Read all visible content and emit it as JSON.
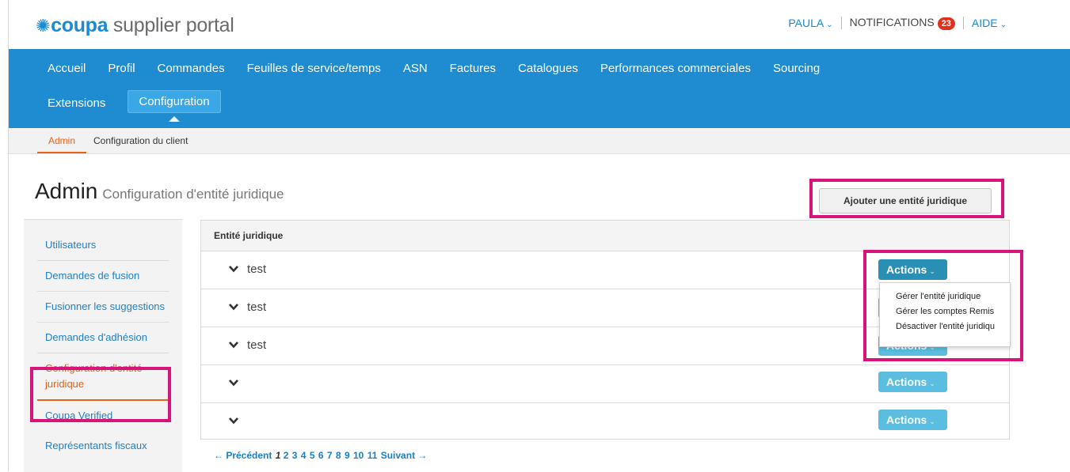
{
  "header": {
    "logo_brand": "coupa",
    "logo_rest": "supplier portal",
    "user": "PAULA",
    "notifications_label": "NOTIFICATIONS",
    "notifications_count": "23",
    "help": "AIDE"
  },
  "nav": {
    "row1": [
      "Accueil",
      "Profil",
      "Commandes",
      "Feuilles de service/temps",
      "ASN",
      "Factures",
      "Catalogues",
      "Performances commerciales",
      "Sourcing"
    ],
    "extensions": "Extensions",
    "configuration": "Configuration"
  },
  "subnav": {
    "admin": "Admin",
    "client_config": "Configuration du client"
  },
  "page": {
    "title": "Admin",
    "subtitle": "Configuration d'entité juridique",
    "add_button": "Ajouter une entité juridique"
  },
  "sidebar": {
    "items": [
      "Utilisateurs",
      "Demandes de fusion",
      "Fusionner les suggestions",
      "Demandes d'adhésion",
      "Configuration d'entité juridique",
      "Coupa Verified",
      "Représentants fiscaux"
    ]
  },
  "table": {
    "header": "Entité juridique",
    "rows": [
      {
        "name": "test"
      },
      {
        "name": "test"
      },
      {
        "name": "test"
      },
      {
        "name": ""
      },
      {
        "name": ""
      }
    ],
    "actions_label": "Actions"
  },
  "dropdown": {
    "items": [
      "Gérer l'entité juridique",
      "Gérer les comptes Remis",
      "Désactiver l'entité juridiqu"
    ]
  },
  "pagination": {
    "prev": "← Précédent",
    "current": "1",
    "pages": [
      "2",
      "3",
      "4",
      "5",
      "6",
      "7",
      "8",
      "9",
      "10",
      "11"
    ],
    "next": "Suivant →"
  },
  "colors": {
    "nav_blue": "#1f8bd0",
    "accent_orange": "#e8621a",
    "highlight_pink": "#d8147a",
    "actions_blue": "#5bbde0"
  }
}
